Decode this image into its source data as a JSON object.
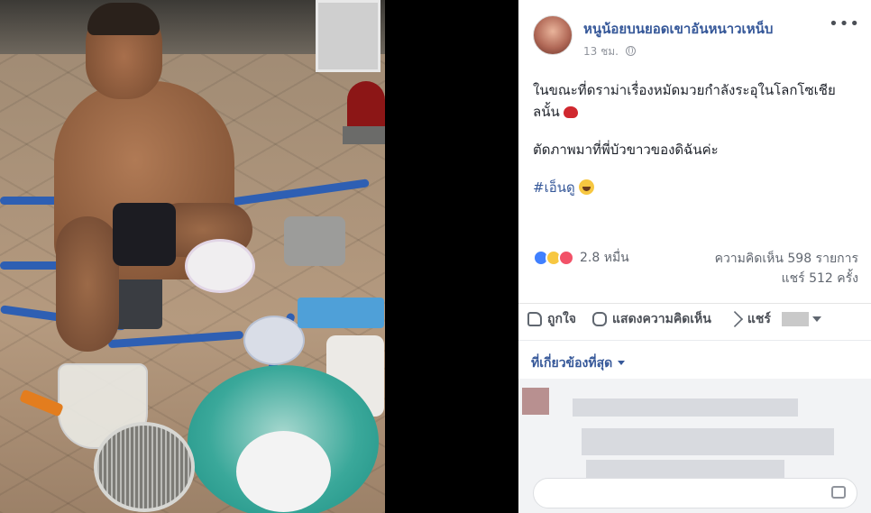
{
  "post": {
    "author": "หนูน้อยบนยอดเขาอันหนาวเหน็บ",
    "time": "13 ชม.",
    "more_label": "•••",
    "paragraph1": "ในขณะที่ดราม่าเรื่องหมัดมวยกำลังระอุในโลกโซเชียลนั้น",
    "paragraph2": "ตัดภาพมาที่พี่บัวขาวของดิฉันค่ะ",
    "hashtag": "#เอ็นดู",
    "reaction_count": "2.8 หมื่น",
    "comment_count": "ความคิดเห็น 598 รายการ",
    "share_count": "แชร์ 512 ครั้ง"
  },
  "actions": {
    "like": "ถูกใจ",
    "comment": "แสดงความคิดเห็น",
    "share": "แชร์"
  },
  "comments": {
    "filter_label": "ที่เกี่ยวข้องที่สุด"
  },
  "icons": {
    "reactions": [
      "like-icon",
      "haha-icon",
      "love-icon"
    ],
    "emoji_after_paragraph1": "boxing-glove-icon",
    "emoji_after_hashtag": "laughing-face-icon"
  },
  "colors": {
    "link": "#365899",
    "like": "#4080ff",
    "love": "#f25268",
    "haha": "#f7c741"
  }
}
